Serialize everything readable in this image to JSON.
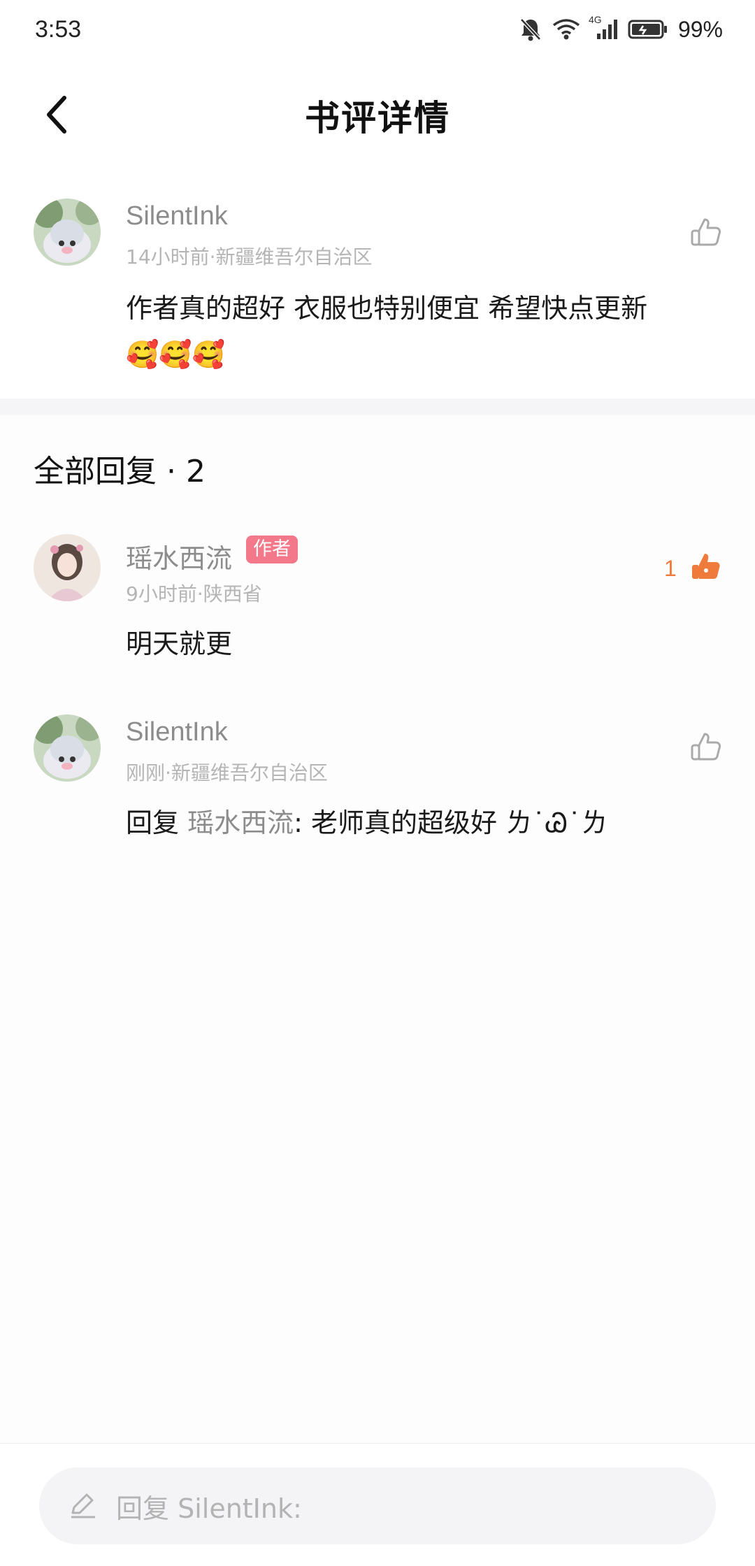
{
  "status_bar": {
    "time": "3:53",
    "network": "4G",
    "battery": "99%",
    "icons": [
      "bell-muted-icon",
      "wifi-icon",
      "signal-icon",
      "battery-icon"
    ]
  },
  "header": {
    "title": "书评详情",
    "back_icon": "chevron-left-icon"
  },
  "review": {
    "username": "SilentInk",
    "meta": "14小时前·新疆维吾尔自治区",
    "content_line1": "作者真的超好 衣服也特别便宜 希望快点更新",
    "content_line2": "🥰🥰🥰",
    "like_icon": "thumbs-up-outline-icon"
  },
  "replies": {
    "title": "全部回复 · 2",
    "items": [
      {
        "username": "瑶水西流",
        "badge": "作者",
        "meta": "9小时前·陕西省",
        "content": "明天就更",
        "like_count": "1",
        "liked": true
      },
      {
        "username": "SilentInk",
        "meta": "刚刚·新疆维吾尔自治区",
        "content_prefix": "回复 ",
        "mention": "瑶水西流",
        "content_suffix": ":  老师真的超级好 ㄌ˙Ꮚ˙ㄌ",
        "liked": false
      }
    ]
  },
  "bottom": {
    "placeholder": "回复 SilentInk:",
    "icon": "pencil-icon"
  },
  "colors": {
    "accent_orange": "#ee7a3b",
    "author_badge": "#f2788a",
    "muted_text": "#8c8c8c"
  }
}
